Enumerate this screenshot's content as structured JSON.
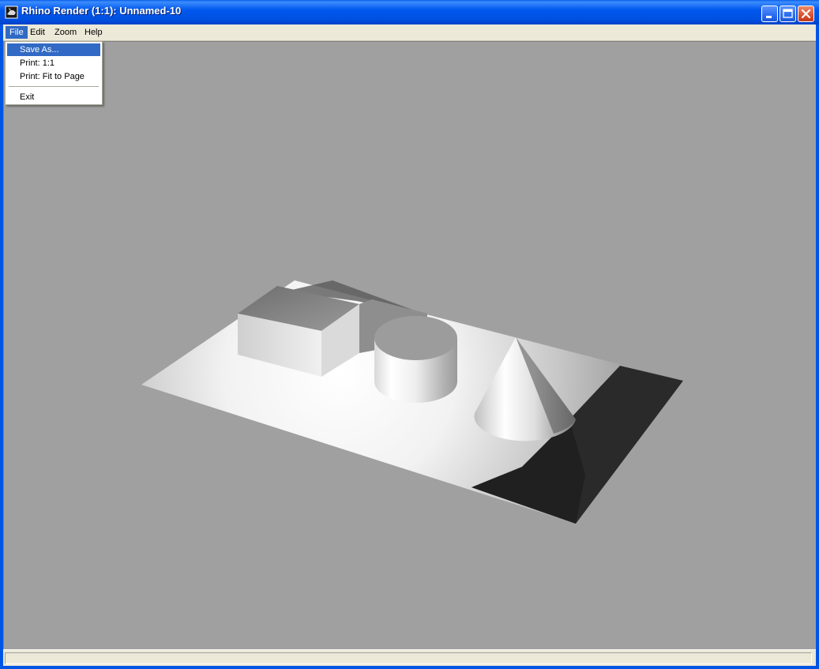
{
  "window": {
    "title": "Rhino Render (1:1): Unnamed-10",
    "icon": "rhino-app-icon",
    "controls": [
      "minimize-icon",
      "maximize-icon",
      "close-icon"
    ]
  },
  "menubar": {
    "items": [
      {
        "label": "File",
        "active": true
      },
      {
        "label": "Edit",
        "active": false
      },
      {
        "label": "Zoom",
        "active": false
      },
      {
        "label": "Help",
        "active": false
      }
    ]
  },
  "file_menu": {
    "items": [
      {
        "label": "Save As...",
        "highlighted": true
      },
      {
        "label": "Print: 1:1",
        "highlighted": false
      },
      {
        "label": "Print: Fit to Page",
        "highlighted": false
      },
      {
        "label": "Exit",
        "highlighted": false
      }
    ]
  },
  "viewport": {
    "background_color": "#a0a0a0",
    "scene": "rendered-plane-with-box-cylinder-cone"
  },
  "colors": {
    "titlebar": "#0058ee",
    "menu_highlight": "#316ac5",
    "chrome": "#ece9d8"
  }
}
